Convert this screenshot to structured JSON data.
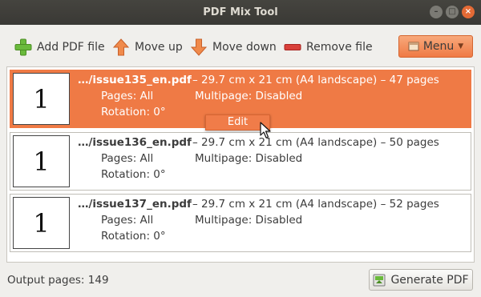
{
  "window": {
    "title": "PDF Mix Tool",
    "controls": [
      "minimize",
      "maximize",
      "close"
    ]
  },
  "toolbar": {
    "add_label": "Add PDF file",
    "up_label": "Move up",
    "down_label": "Move down",
    "remove_label": "Remove file",
    "menu_label": "Menu"
  },
  "files": [
    {
      "name": "…/issue135_en.pdf",
      "desc": "– 29.7 cm x 21 cm (A4 landscape) – 47 pages",
      "pages": "Pages: All",
      "multipage": "Multipage: Disabled",
      "rotation": "Rotation: 0°",
      "thumb": "1",
      "selected": true
    },
    {
      "name": "…/issue136_en.pdf",
      "desc": "– 29.7 cm x 21 cm (A4 landscape) – 50 pages",
      "pages": "Pages: All",
      "multipage": "Multipage: Disabled",
      "rotation": "Rotation: 0°",
      "thumb": "1",
      "selected": false
    },
    {
      "name": "…/issue137_en.pdf",
      "desc": "– 29.7 cm x 21 cm (A4 landscape) – 52 pages",
      "pages": "Pages: All",
      "multipage": "Multipage: Disabled",
      "rotation": "Rotation: 0°",
      "thumb": "1",
      "selected": false
    }
  ],
  "context": {
    "edit_label": "Edit"
  },
  "status": {
    "output_pages": "Output pages: 149"
  },
  "generate_label": "Generate PDF",
  "colors": {
    "accent": "#ef7a45",
    "titlebar": "#3a3935",
    "background": "#f0efec"
  }
}
